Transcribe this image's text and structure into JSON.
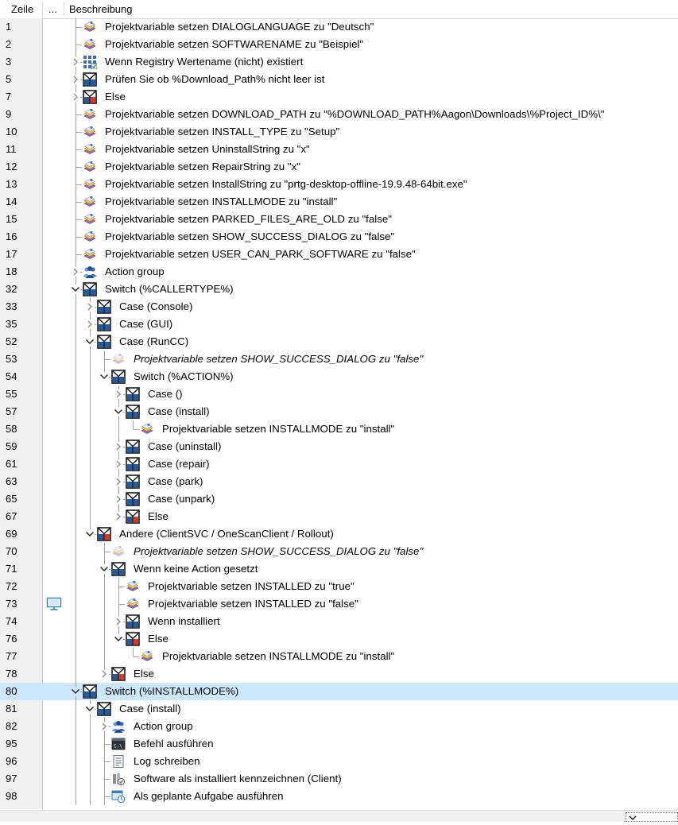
{
  "header": {
    "col_line": "Zeile",
    "col_more": "...",
    "col_desc": "Beschreibung"
  },
  "rows": [
    {
      "n": "1",
      "d": 1,
      "exp": "none",
      "icon": "proj",
      "label": "Projektvariable setzen DIALOGLANGUAGE zu \"Deutsch\""
    },
    {
      "n": "2",
      "d": 1,
      "exp": "none",
      "icon": "proj",
      "label": "Projektvariable setzen SOFTWARENAME zu \"Beispiel\""
    },
    {
      "n": "3",
      "d": 1,
      "exp": "c",
      "icon": "registry",
      "label": "Wenn Registry Wertename (nicht) existiert"
    },
    {
      "n": "5",
      "d": 1,
      "exp": "c",
      "icon": "cond",
      "label": "Prüfen Sie ob %Download_Path% nicht leer ist"
    },
    {
      "n": "7",
      "d": 1,
      "exp": "c",
      "icon": "else",
      "label": "Else"
    },
    {
      "n": "9",
      "d": 1,
      "exp": "none",
      "icon": "proj",
      "label": "Projektvariable setzen DOWNLOAD_PATH zu \"%DOWNLOAD_PATH%Aagon\\Downloads\\%Project_ID%\\\""
    },
    {
      "n": "10",
      "d": 1,
      "exp": "none",
      "icon": "proj",
      "label": "Projektvariable setzen INSTALL_TYPE zu \"Setup\""
    },
    {
      "n": "11",
      "d": 1,
      "exp": "none",
      "icon": "proj",
      "label": "Projektvariable setzen UninstallString zu \"x\""
    },
    {
      "n": "12",
      "d": 1,
      "exp": "none",
      "icon": "proj",
      "label": "Projektvariable setzen RepairString zu \"x\""
    },
    {
      "n": "13",
      "d": 1,
      "exp": "none",
      "icon": "proj",
      "label": "Projektvariable setzen InstallString zu \"prtg-desktop-offline-19.9.48-64bit.exe\""
    },
    {
      "n": "14",
      "d": 1,
      "exp": "none",
      "icon": "proj",
      "label": "Projektvariable setzen INSTALLMODE zu \"install\""
    },
    {
      "n": "15",
      "d": 1,
      "exp": "none",
      "icon": "proj",
      "label": "Projektvariable setzen PARKED_FILES_ARE_OLD zu \"false\""
    },
    {
      "n": "16",
      "d": 1,
      "exp": "none",
      "icon": "proj",
      "label": "Projektvariable setzen SHOW_SUCCESS_DIALOG zu \"false\""
    },
    {
      "n": "17",
      "d": 1,
      "exp": "none",
      "icon": "proj",
      "label": "Projektvariable setzen USER_CAN_PARK_SOFTWARE zu \"false\""
    },
    {
      "n": "18",
      "d": 1,
      "exp": "c",
      "icon": "group",
      "label": "Action group"
    },
    {
      "n": "32",
      "d": 1,
      "exp": "o",
      "icon": "switch",
      "label": "Switch (%CALLERTYPE%)"
    },
    {
      "n": "33",
      "d": 2,
      "exp": "c",
      "icon": "cond",
      "label": "Case (Console)"
    },
    {
      "n": "35",
      "d": 2,
      "exp": "c",
      "icon": "cond",
      "label": "Case (GUI)"
    },
    {
      "n": "52",
      "d": 2,
      "exp": "o",
      "icon": "cond",
      "label": "Case (RunCC)"
    },
    {
      "n": "53",
      "d": 3,
      "exp": "none",
      "icon": "proj-dis",
      "label": "Projektvariable setzen SHOW_SUCCESS_DIALOG zu \"false\"",
      "it": true
    },
    {
      "n": "54",
      "d": 3,
      "exp": "o",
      "icon": "switch",
      "label": "Switch (%ACTION%)"
    },
    {
      "n": "55",
      "d": 4,
      "exp": "c",
      "icon": "cond",
      "label": "Case ()"
    },
    {
      "n": "57",
      "d": 4,
      "exp": "o",
      "icon": "cond",
      "label": "Case (install)"
    },
    {
      "n": "58",
      "d": 5,
      "exp": "none",
      "icon": "proj",
      "label": "Projektvariable setzen INSTALLMODE zu \"install\""
    },
    {
      "n": "59",
      "d": 4,
      "exp": "c",
      "icon": "cond",
      "label": "Case (uninstall)"
    },
    {
      "n": "61",
      "d": 4,
      "exp": "c",
      "icon": "cond",
      "label": "Case (repair)"
    },
    {
      "n": "63",
      "d": 4,
      "exp": "c",
      "icon": "cond",
      "label": "Case (park)"
    },
    {
      "n": "65",
      "d": 4,
      "exp": "c",
      "icon": "cond",
      "label": "Case (unpark)"
    },
    {
      "n": "67",
      "d": 4,
      "exp": "c",
      "icon": "else",
      "label": "Else"
    },
    {
      "n": "69",
      "d": 2,
      "exp": "o",
      "icon": "else",
      "label": "Andere (ClientSVC / OneScanClient / Rollout)"
    },
    {
      "n": "70",
      "d": 3,
      "exp": "none",
      "icon": "proj-dis",
      "label": "Projektvariable setzen SHOW_SUCCESS_DIALOG zu \"false\"",
      "it": true
    },
    {
      "n": "71",
      "d": 3,
      "exp": "o",
      "icon": "cond",
      "label": "Wenn keine Action gesetzt"
    },
    {
      "n": "72",
      "d": 4,
      "exp": "none",
      "icon": "proj",
      "label": "Projektvariable setzen INSTALLED zu \"true\""
    },
    {
      "n": "73",
      "d": 4,
      "exp": "none",
      "icon": "proj",
      "label": "Projektvariable setzen INSTALLED zu \"false\"",
      "mon": true
    },
    {
      "n": "74",
      "d": 4,
      "exp": "c",
      "icon": "cond",
      "label": "Wenn installiert"
    },
    {
      "n": "76",
      "d": 4,
      "exp": "o",
      "icon": "else",
      "label": "Else"
    },
    {
      "n": "77",
      "d": 5,
      "exp": "none",
      "icon": "proj",
      "label": "Projektvariable setzen INSTALLMODE zu \"install\""
    },
    {
      "n": "78",
      "d": 3,
      "exp": "c",
      "icon": "else",
      "label": "Else"
    },
    {
      "n": "80",
      "d": 1,
      "exp": "o",
      "icon": "switch",
      "label": "Switch (%INSTALLMODE%)",
      "sel": true
    },
    {
      "n": "81",
      "d": 2,
      "exp": "o",
      "icon": "cond",
      "label": "Case (install)"
    },
    {
      "n": "82",
      "d": 3,
      "exp": "c",
      "icon": "group",
      "label": "Action group"
    },
    {
      "n": "95",
      "d": 3,
      "exp": "none",
      "icon": "cmd",
      "label": "Befehl ausführen"
    },
    {
      "n": "96",
      "d": 3,
      "exp": "none",
      "icon": "log",
      "label": "Log schreiben"
    },
    {
      "n": "97",
      "d": 3,
      "exp": "none",
      "icon": "software",
      "label": "Software als installiert kennzeichnen (Client)"
    },
    {
      "n": "98",
      "d": 3,
      "exp": "none",
      "icon": "task",
      "label": "Als geplante Aufgabe ausführen"
    }
  ]
}
